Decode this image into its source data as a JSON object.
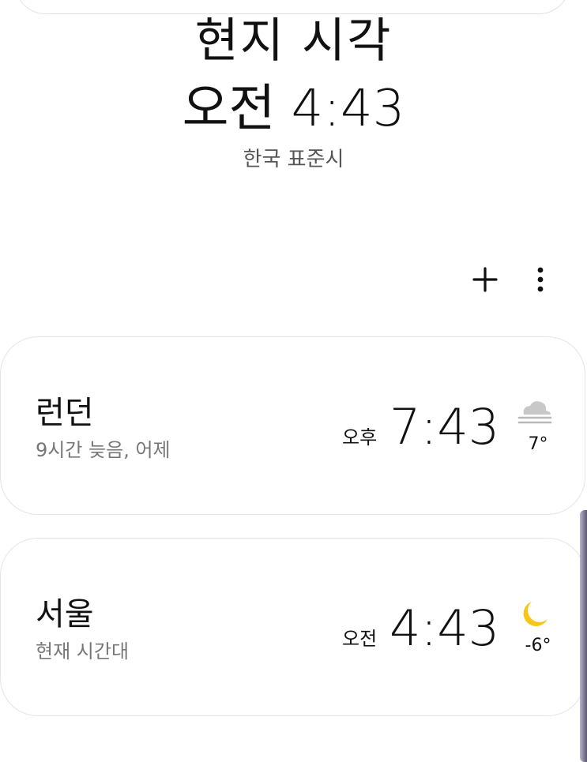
{
  "header": {
    "title": "현지 시각",
    "time": "오전 4:43",
    "timezone": "한국 표준시"
  },
  "toolbar": {
    "add_icon": "plus-icon",
    "more_icon": "more-vert-icon"
  },
  "cities": [
    {
      "name": "런던",
      "description": "9시간 늦음, 어제",
      "ampm": "오후",
      "time": "7:43",
      "weather_icon": "fog-cloud-icon",
      "temperature": "7°"
    },
    {
      "name": "서울",
      "description": "현재 시간대",
      "ampm": "오전",
      "time": "4:43",
      "weather_icon": "crescent-moon-icon",
      "temperature": "-6°"
    }
  ],
  "colors": {
    "background": "#ffffff",
    "card_border": "#e4e4e4",
    "secondary_text": "#777777",
    "moon": "#f5c518",
    "fog": "#b8b8b8"
  }
}
